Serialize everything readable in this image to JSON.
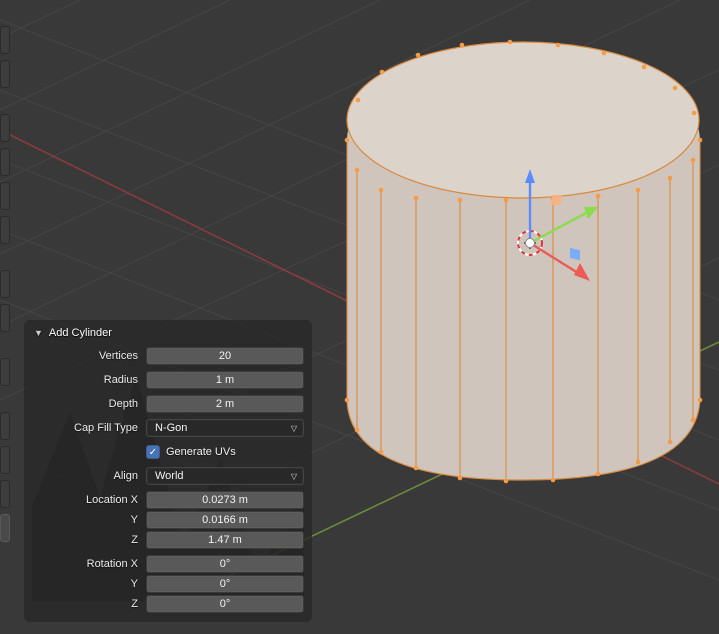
{
  "panel": {
    "title": "Add Cylinder",
    "vertices": {
      "label": "Vertices",
      "value": "20"
    },
    "radius": {
      "label": "Radius",
      "value": "1 m"
    },
    "depth": {
      "label": "Depth",
      "value": "2 m"
    },
    "cap_fill_type": {
      "label": "Cap Fill Type",
      "value": "N-Gon"
    },
    "generate_uvs": {
      "label": "Generate UVs",
      "checked": "✓"
    },
    "align": {
      "label": "Align",
      "value": "World"
    },
    "location_x": {
      "label": "Location X",
      "value": "0.0273 m"
    },
    "location_y": {
      "label": "Y",
      "value": "0.0166 m"
    },
    "location_z": {
      "label": "Z",
      "value": "1.47 m"
    },
    "rotation_x": {
      "label": "Rotation X",
      "value": "0°"
    },
    "rotation_y": {
      "label": "Y",
      "value": "0°"
    },
    "rotation_z": {
      "label": "Z",
      "value": "0°"
    }
  },
  "mesh": {
    "name": "cylinder",
    "segments": 20,
    "vertex_color": "#f79b44",
    "edge_color": "#d88a3f",
    "top_fill": "#dcd3cb",
    "side_fill": "#cfc5bc"
  },
  "gizmo": {
    "x_color": "#ec5b55",
    "y_color": "#8bdc4b",
    "z_color": "#5a8cff"
  },
  "grid": {
    "line_color": "#4b4b4b",
    "axis_x_color": "#8a3b3b",
    "axis_y_color": "#6d8a3b"
  }
}
